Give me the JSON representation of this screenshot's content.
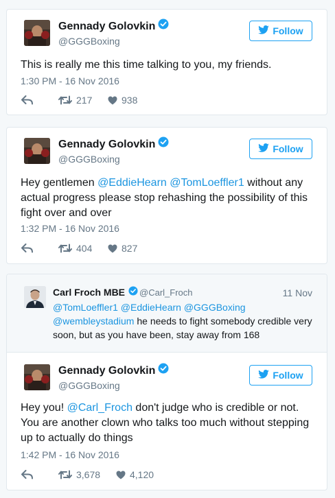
{
  "colors": {
    "accent": "#1da1f2",
    "mention": "#1b95e0",
    "muted": "#657786",
    "text": "#14171a",
    "background": "#f5f8fa"
  },
  "follow_label": "Follow",
  "tweets": [
    {
      "name": "Gennady Golovkin",
      "handle": "@GGGBoxing",
      "verified": true,
      "text": "This is really me this time talking to you, my friends.",
      "time": "1:30 PM - 16 Nov 2016",
      "retweets": "217",
      "likes": "938"
    },
    {
      "name": "Gennady Golovkin",
      "handle": "@GGGBoxing",
      "verified": true,
      "text_parts": [
        "Hey gentlemen ",
        "@EddieHearn",
        " ",
        "@TomLoeffler1",
        " without any actual progress please stop rehashing the possibility of this fight over and over"
      ],
      "time": "1:32 PM - 16 Nov 2016",
      "retweets": "404",
      "likes": "827"
    },
    {
      "name": "Gennady Golovkin",
      "handle": "@GGGBoxing",
      "verified": true,
      "text_parts": [
        "Hey you! ",
        "@Carl_Froch",
        " don't judge who is credible or not. You are another clown who talks too much without stepping up to actually do things"
      ],
      "time": "1:42 PM - 16 Nov 2016",
      "retweets": "3,678",
      "likes": "4,120"
    }
  ],
  "quoted": {
    "name": "Carl Froch MBE",
    "handle": "@Carl_Froch",
    "verified": true,
    "date": "11 Nov",
    "text_parts": [
      "@TomLoeffler1",
      " ",
      "@EddieHearn",
      " ",
      "@GGGBoxing",
      " ",
      "@wembleystadium",
      " he needs to fight somebody credible very soon, but as you have been, stay away from 168"
    ]
  },
  "icons": {
    "reply": "reply-icon",
    "retweet": "retweet-icon",
    "like": "heart-icon",
    "verified": "verified-badge-icon",
    "follow": "twitter-bird-icon"
  }
}
